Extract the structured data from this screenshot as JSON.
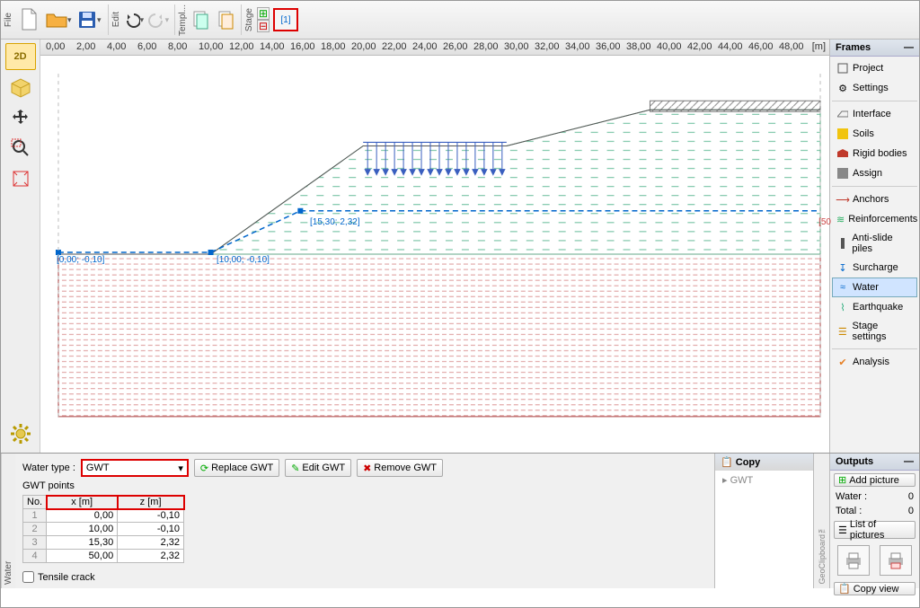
{
  "toolbar": {
    "file_label": "File",
    "edit_label": "Edit",
    "templ_label": "Templ...",
    "stage_label": "Stage",
    "stage_number": "[1]"
  },
  "left_tools": {
    "view2d": "2D",
    "view3d": "3D"
  },
  "ruler": {
    "ticks": [
      "0,00",
      "2,00",
      "4,00",
      "6,00",
      "8,00",
      "10,00",
      "12,00",
      "14,00",
      "16,00",
      "18,00",
      "20,00",
      "22,00",
      "24,00",
      "26,00",
      "28,00",
      "30,00",
      "32,00",
      "34,00",
      "36,00",
      "38,00",
      "40,00",
      "42,00",
      "44,00",
      "46,00",
      "48,00"
    ],
    "unit": "[m]"
  },
  "canvas_labels": {
    "pt1": "[15,30; 2,32]",
    "pt2": "[10,00; -0,10]",
    "pt3": "[0,00; -0,10]",
    "right_num": "[50"
  },
  "frames": {
    "title": "Frames",
    "items": [
      "Project",
      "Settings",
      "Interface",
      "Soils",
      "Rigid bodies",
      "Assign",
      "Anchors",
      "Reinforcements",
      "Anti-slide piles",
      "Surcharge",
      "Water",
      "Earthquake",
      "Stage settings",
      "Analysis"
    ],
    "active": "Water"
  },
  "water": {
    "panel_label": "Water",
    "type_label": "Water type :",
    "type_value": "GWT",
    "replace": "Replace GWT",
    "edit": "Edit GWT",
    "remove": "Remove GWT",
    "points_label": "GWT points",
    "table": {
      "headers": [
        "No.",
        "x [m]",
        "z [m]"
      ],
      "rows": [
        [
          "1",
          "0,00",
          "-0,10"
        ],
        [
          "2",
          "10,00",
          "-0,10"
        ],
        [
          "3",
          "15,30",
          "2,32"
        ],
        [
          "4",
          "50,00",
          "2,32"
        ]
      ]
    },
    "tensile_crack": "Tensile crack"
  },
  "copy": {
    "title": "Copy",
    "item": "GWT",
    "geoclip": "GeoClipboard™"
  },
  "outputs": {
    "title": "Outputs",
    "add_picture": "Add picture",
    "water_label": "Water :",
    "water_count": "0",
    "total_label": "Total :",
    "total_count": "0",
    "list": "List of pictures",
    "copy_view": "Copy view"
  }
}
